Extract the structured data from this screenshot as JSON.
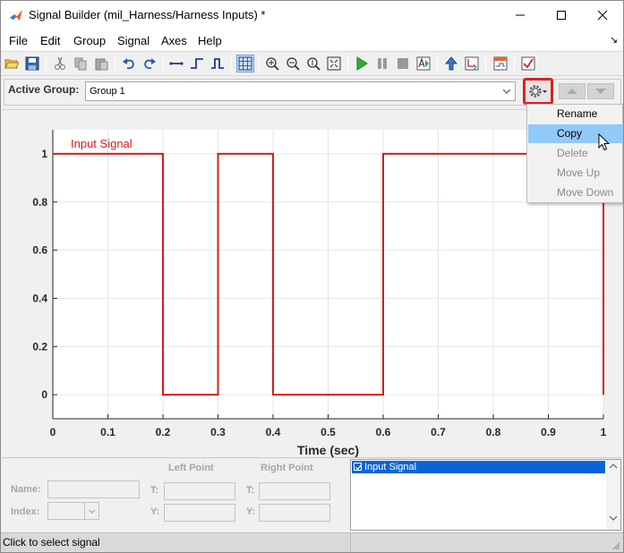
{
  "window": {
    "title": "Signal Builder (mil_Harness/Harness Inputs) *"
  },
  "menu": {
    "items": [
      {
        "label": "File"
      },
      {
        "label": "Edit"
      },
      {
        "label": "Group"
      },
      {
        "label": "Signal"
      },
      {
        "label": "Axes"
      },
      {
        "label": "Help"
      }
    ],
    "undock_glyph": "↘"
  },
  "toolbar": {
    "icons": [
      "open-icon",
      "save-icon",
      "cut-icon",
      "copy-icon",
      "paste-icon",
      "undo-icon",
      "redo-icon",
      "insert-line-icon",
      "insert-step-icon",
      "insert-pulse-icon",
      "grid-icon",
      "zoom-xy-icon",
      "zoom-x-icon",
      "zoom-in-icon",
      "fit-view-icon",
      "play-icon",
      "pause-icon",
      "stop-icon",
      "run-all-icon",
      "send-to-workspace-icon",
      "import-icon",
      "open-report-icon",
      "verify-icon"
    ]
  },
  "active_group": {
    "label": "Active Group:",
    "value": "Group 1",
    "gear_icon": "gear-dropdown-icon"
  },
  "context_menu": {
    "items": [
      {
        "label": "Rename",
        "enabled": true,
        "hover": false
      },
      {
        "label": "Copy",
        "enabled": true,
        "hover": true
      },
      {
        "label": "Delete",
        "enabled": false,
        "hover": false
      },
      {
        "label": "Move Up",
        "enabled": false,
        "hover": false
      },
      {
        "label": "Move Down",
        "enabled": false,
        "hover": false
      }
    ]
  },
  "chart_data": {
    "type": "line",
    "xlabel": "Time (sec)",
    "ylabel": "",
    "title": "",
    "xlim": [
      0,
      1
    ],
    "ylim": [
      -0.1,
      1.1
    ],
    "x_ticks": [
      0,
      0.1,
      0.2,
      0.3,
      0.4,
      0.5,
      0.6,
      0.7,
      0.8,
      0.9,
      1
    ],
    "y_ticks": [
      0,
      0.2,
      0.4,
      0.6,
      0.8,
      1
    ],
    "x_tick_labels": [
      "0",
      "0.1",
      "0.2",
      "0.3",
      "0.4",
      "0.5",
      "0.6",
      "0.7",
      "0.8",
      "0.9",
      "1"
    ],
    "y_tick_labels": [
      "0",
      "0.2",
      "0.4",
      "0.6",
      "0.8",
      "1"
    ],
    "grid": true,
    "series": [
      {
        "name": "Input Signal",
        "color": "#d41c1c",
        "x": [
          0,
          0.2,
          0.2,
          0.3,
          0.3,
          0.4,
          0.4,
          0.6,
          0.6,
          1,
          1
        ],
        "y": [
          1,
          1,
          0,
          0,
          1,
          1,
          0,
          0,
          1,
          1,
          0
        ]
      }
    ]
  },
  "point_editor": {
    "name_label": "Name:",
    "index_label": "Index:",
    "left_point_label": "Left Point",
    "right_point_label": "Right Point",
    "t_label": "T:",
    "y_label": "Y:"
  },
  "signal_list": {
    "items": [
      {
        "label": "Input Signal",
        "checked": true,
        "selected": true
      }
    ]
  },
  "status": {
    "text": "Click to select signal"
  },
  "colors": {
    "accent_red": "#e02020",
    "selection_blue": "#0a64d6",
    "menu_hover": "#91c9f7",
    "signal_red": "#d41c1c"
  }
}
